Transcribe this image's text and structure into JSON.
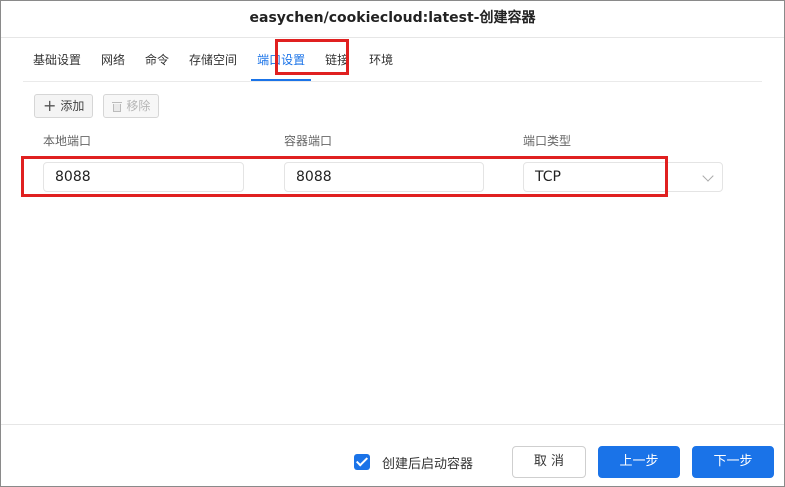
{
  "window": {
    "title": "easychen/cookiecloud:latest-创建容器"
  },
  "tabs": [
    {
      "label": "基础设置",
      "active": false
    },
    {
      "label": "网络",
      "active": false
    },
    {
      "label": "命令",
      "active": false
    },
    {
      "label": "存储空间",
      "active": false
    },
    {
      "label": "端口设置",
      "active": true
    },
    {
      "label": "链接",
      "active": false
    },
    {
      "label": "环境",
      "active": false
    }
  ],
  "toolbar": {
    "add_label": "添加",
    "remove_label": "移除",
    "add_icon": "plus-icon",
    "remove_icon": "trash-icon"
  },
  "table": {
    "columns": [
      "本地端口",
      "容器端口",
      "端口类型"
    ],
    "rows": [
      {
        "local_port": "8088",
        "container_port": "8088",
        "protocol": "TCP"
      }
    ]
  },
  "footer": {
    "start_after_create_label": "创建后启动容器",
    "start_after_create_checked": true,
    "cancel_label": "取 消",
    "prev_label": "上一步",
    "next_label": "下一步"
  },
  "colors": {
    "accent": "#1a73e8",
    "highlight_box": "#e02020"
  }
}
